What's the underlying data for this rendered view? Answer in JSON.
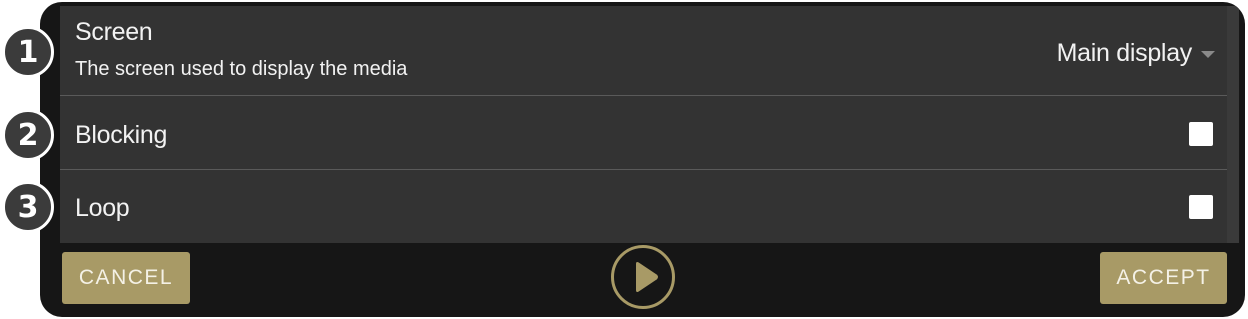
{
  "settings": {
    "screen": {
      "label": "Screen",
      "description": "The screen used to display the media",
      "selected": "Main display"
    },
    "blocking": {
      "label": "Blocking",
      "checked": false
    },
    "loop": {
      "label": "Loop",
      "checked": false
    }
  },
  "footer": {
    "cancel_label": "CANCEL",
    "accept_label": "ACCEPT",
    "play_icon": "play-icon"
  },
  "badges": [
    "1",
    "2",
    "3"
  ],
  "colors": {
    "accent": "#a89a66",
    "panel": "#333333",
    "frame": "#161616",
    "divider": "#5a5a5a"
  }
}
